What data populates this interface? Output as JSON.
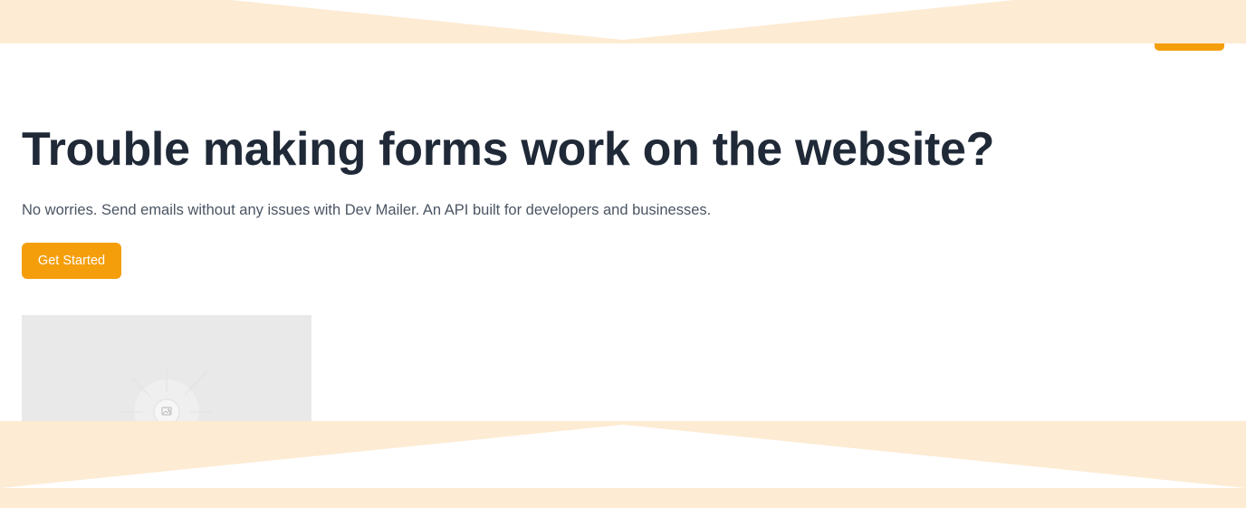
{
  "hero": {
    "title": "Trouble making forms work on the website?",
    "subtitle": "No worries. Send emails without any issues with Dev Mailer. An API built for developers and businesses.",
    "cta_label": "Get Started"
  },
  "image_placeholder": {
    "icon": "image-icon"
  },
  "colors": {
    "accent": "#f59e0b",
    "band": "#fdebd3",
    "title": "#1f2937",
    "subtitle": "#4b5563",
    "placeholder_bg": "#e9e9e9"
  }
}
